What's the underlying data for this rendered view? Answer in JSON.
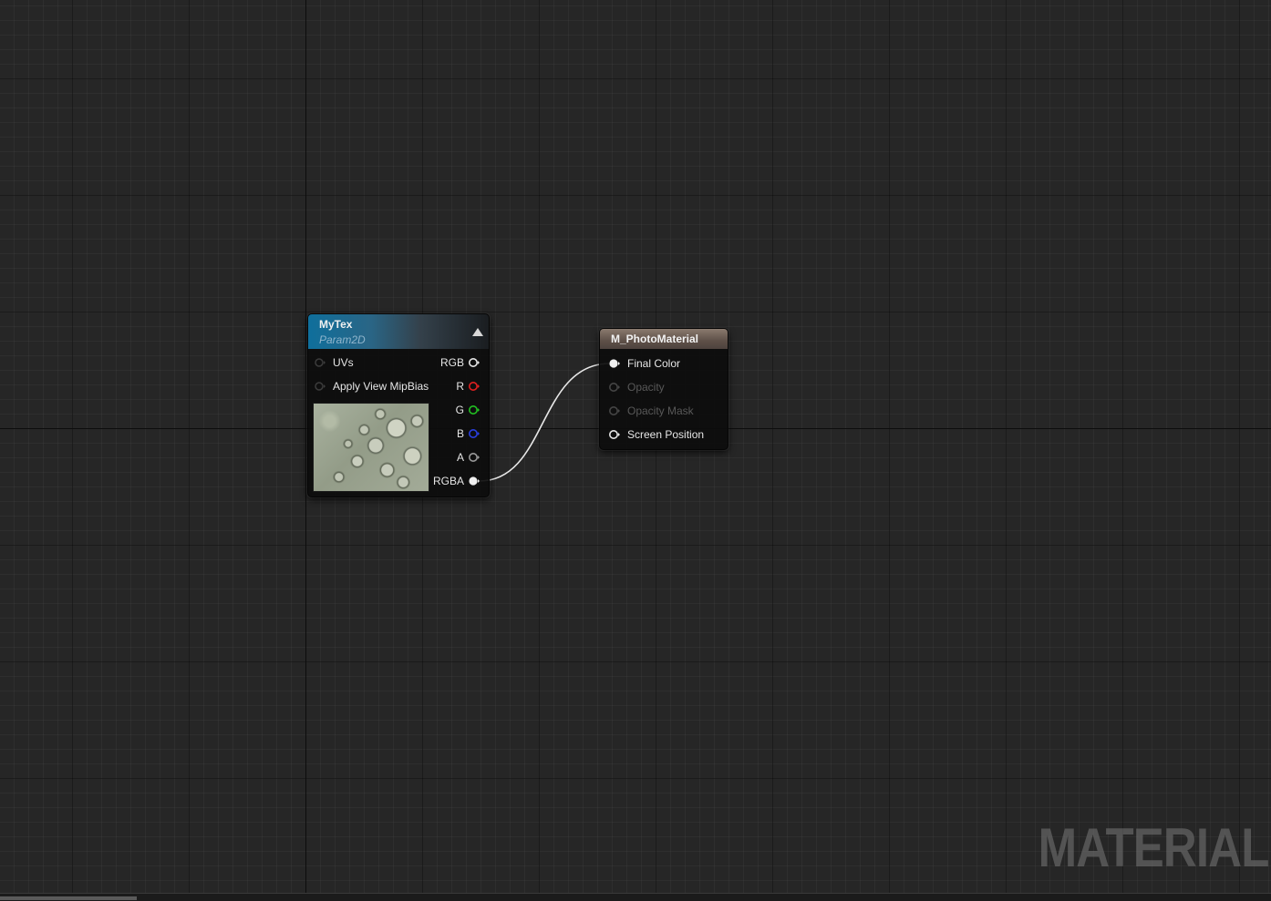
{
  "graph": {
    "watermark": "MATERIAL"
  },
  "texture_node": {
    "title": "MyTex",
    "subtitle": "Param2D",
    "header_color": "#0f6f9c",
    "inputs": [
      {
        "label": "UVs"
      },
      {
        "label": "Apply View MipBias"
      }
    ],
    "outputs": [
      {
        "label": "RGB",
        "color": "#e6e6e6",
        "connected": false
      },
      {
        "label": "R",
        "color": "#e02020",
        "connected": false
      },
      {
        "label": "G",
        "color": "#22c022",
        "connected": false
      },
      {
        "label": "B",
        "color": "#2a3fe0",
        "connected": false
      },
      {
        "label": "A",
        "color": "#9a9a9a",
        "connected": false
      },
      {
        "label": "RGBA",
        "color": "#f0f0f0",
        "connected": true
      }
    ]
  },
  "material_node": {
    "title": "M_PhotoMaterial",
    "header_color": "#6e6058",
    "inputs": [
      {
        "label": "Final Color",
        "enabled": true,
        "connected": true
      },
      {
        "label": "Opacity",
        "enabled": false,
        "connected": false
      },
      {
        "label": "Opacity Mask",
        "enabled": false,
        "connected": false
      },
      {
        "label": "Screen Position",
        "enabled": true,
        "connected": false
      }
    ]
  },
  "wire_color": "#e8e8e8"
}
